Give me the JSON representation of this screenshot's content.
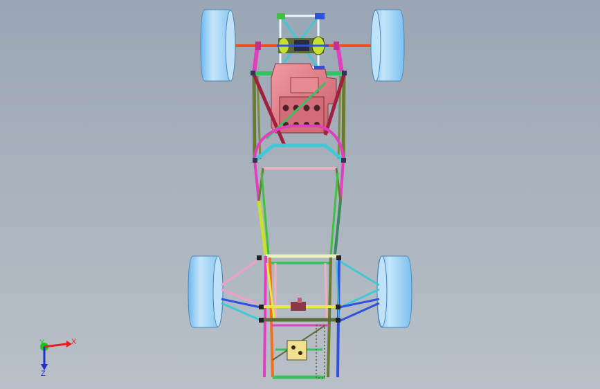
{
  "viewport": {
    "background_top": "#9aa6b4",
    "background_bottom": "#b9c0c7"
  },
  "triad": {
    "x_label": "X",
    "y_label": "Y",
    "z_label": "Z",
    "x_color": "#e02020",
    "y_color": "#20c020",
    "z_color": "#2030d0"
  },
  "colors": {
    "tire": "#9fd0f3",
    "engine": "#e07a84",
    "frame_green": "#5ad050",
    "frame_magenta": "#e040c0",
    "frame_cyan": "#40c8d8",
    "frame_yellow": "#e8e840",
    "frame_orange": "#f07020",
    "frame_pink": "#f0b0c0",
    "frame_olive": "#6a7a30",
    "frame_blue": "#3050e0",
    "axle": "#f05020",
    "maroon": "#a02040"
  }
}
